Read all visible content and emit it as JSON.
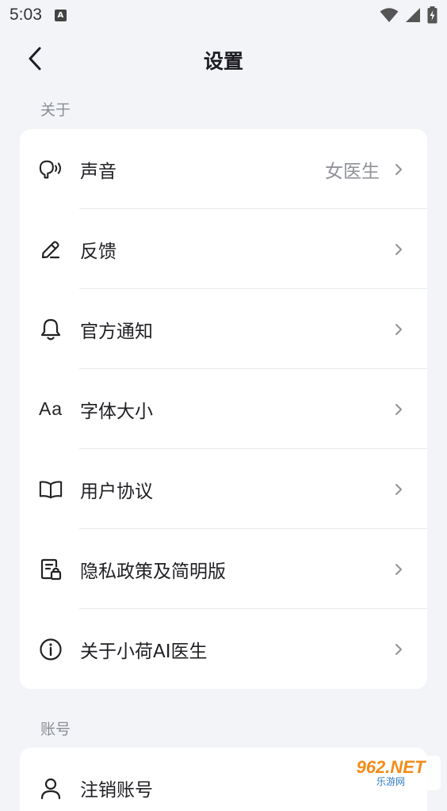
{
  "status_bar": {
    "time": "5:03",
    "notif_icon_letter": "A",
    "icons": [
      "wifi-icon",
      "signal-icon",
      "battery-charging-icon"
    ]
  },
  "header": {
    "title": "设置",
    "back_icon": "chevron-left-icon"
  },
  "sections": [
    {
      "label": "关于",
      "items": [
        {
          "icon": "voice-icon",
          "label": "声音",
          "value": "女医生"
        },
        {
          "icon": "pencil-icon",
          "label": "反馈",
          "value": ""
        },
        {
          "icon": "bell-icon",
          "label": "官方通知",
          "value": ""
        },
        {
          "icon": "font-size-icon",
          "icon_text": "Aa",
          "label": "字体大小",
          "value": ""
        },
        {
          "icon": "book-icon",
          "label": "用户协议",
          "value": ""
        },
        {
          "icon": "privacy-doc-lock-icon",
          "label": "隐私政策及简明版",
          "value": ""
        },
        {
          "icon": "info-icon",
          "label": "关于小荷AI医生",
          "value": ""
        }
      ]
    },
    {
      "label": "账号",
      "items": [
        {
          "icon": "user-icon",
          "label": "注销账号",
          "value": ""
        }
      ]
    }
  ],
  "watermark": {
    "top": "962.NET",
    "bottom": "乐游网"
  },
  "colors": {
    "background": "#f2f4f8",
    "card": "#ffffff",
    "text": "#1f1f24",
    "secondary_text": "#8f9297"
  }
}
